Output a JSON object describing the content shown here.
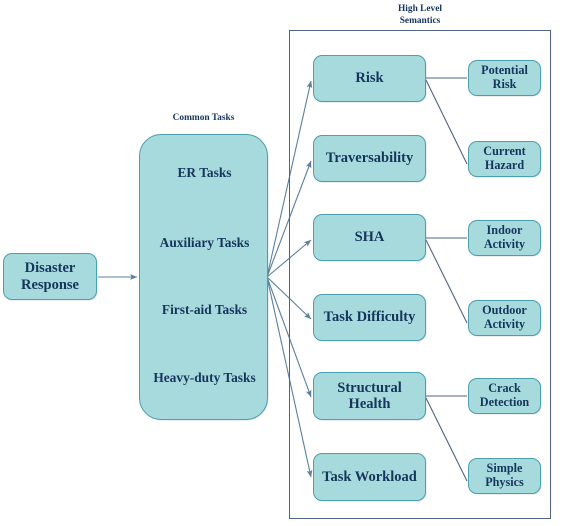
{
  "diagram": {
    "title_root": "Disaster Response",
    "groups": {
      "common_tasks": {
        "label": "Common Tasks",
        "items": [
          {
            "label": "ER Tasks"
          },
          {
            "label": "Auxiliary Tasks"
          },
          {
            "label": "First-aid Tasks"
          },
          {
            "label": "Heavy-duty Tasks"
          }
        ]
      },
      "high_level_semantics": {
        "label_line1": "High Level",
        "label_line2": "Semantics",
        "primary_nodes": [
          {
            "label": "Risk"
          },
          {
            "label": "Traversability"
          },
          {
            "label": "SHA"
          },
          {
            "label": "Task Difficulty"
          },
          {
            "label": "Structural Health"
          },
          {
            "label": "Task Workload"
          }
        ],
        "secondary_nodes": [
          {
            "label": "Potential Risk"
          },
          {
            "label": "Current Hazard"
          },
          {
            "label": "Indoor Activity"
          },
          {
            "label": "Outdoor Activity"
          },
          {
            "label": "Crack Detection"
          },
          {
            "label": "Simple Physics"
          }
        ]
      }
    },
    "colors": {
      "node_fill": "#a7dadc",
      "node_stroke": "#4a9fb0",
      "text": "#16355c",
      "edge": "#4d6484",
      "container_stroke": "#4d6484",
      "background": "#ffffff"
    }
  }
}
